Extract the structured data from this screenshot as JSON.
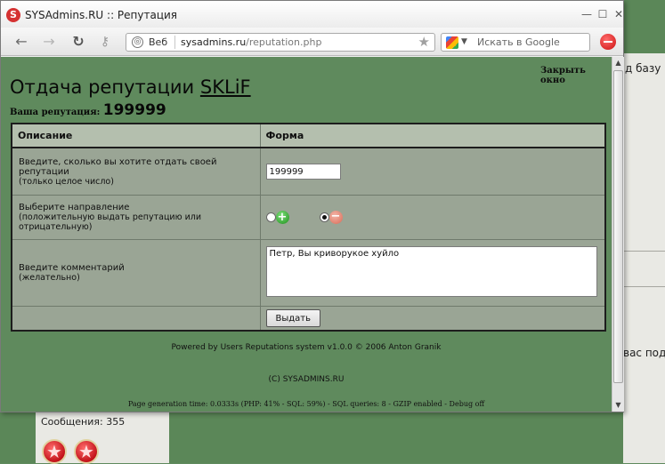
{
  "window": {
    "app_icon": "S",
    "title": "SYSAdmins.RU :: Репутация",
    "min_icon": "—",
    "max_icon": "☐",
    "close_icon": "✕"
  },
  "nav": {
    "back_icon": "←",
    "forward_icon": "→",
    "reload_icon": "↻",
    "key_icon": "⚷",
    "web_label": "Веб",
    "url_host": "sysadmins.ru",
    "url_path": "/reputation.php",
    "star_icon": "★",
    "search_placeholder": "Искать в Google",
    "search_chevron": "▼"
  },
  "content": {
    "close_link": "Закрыть окно",
    "title_prefix": "Отдача репутации ",
    "title_user": "SKLiF",
    "rep_label": "Ваша репутация: ",
    "rep_value": "199999",
    "table": {
      "header_desc": "Описание",
      "header_form": "Форма",
      "row1_title": "Введите, сколько вы хотите отдать своей репутации",
      "row1_note": "(только целое число)",
      "row1_value": "199999",
      "row2_title": "Выберите направление",
      "row2_note": "(положительную выдать репутацию или отрицательную)",
      "row2_selected": "negative",
      "plus_icon": "+",
      "minus_icon": "−",
      "row3_title": "Введите комментарий",
      "row3_note": "(желательно)",
      "row3_value": "Петр, Вы криворукое хуйло",
      "submit_label": "Выдать"
    },
    "footer_powered": "Powered by Users Reputations system v1.0.0 © 2006 Anton Granik",
    "footer_copyright": "(C) SYSADMINS.RU",
    "footer_stats": "Page generation time: 0.0333s (PHP: 41% - SQL: 59%) - SQL queries: 8 - GZIP enabled - Debug off"
  },
  "scroll": {
    "up_icon": "▲",
    "down_icon": "▼"
  },
  "background": {
    "text_1": "д базу",
    "text_2": "вас под",
    "messages": "Сообщения: 355"
  }
}
